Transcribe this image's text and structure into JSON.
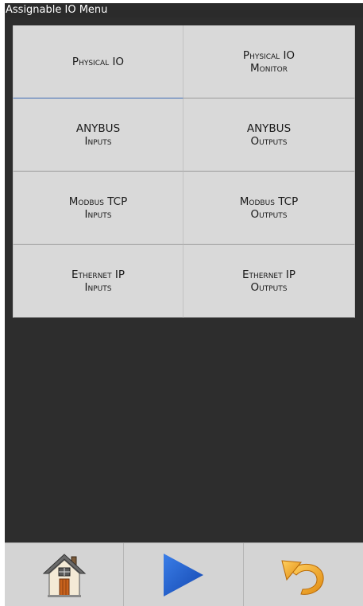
{
  "window": {
    "title": "Assignable IO Menu"
  },
  "menu": {
    "buttons": [
      {
        "line1": "Physical IO",
        "line2": ""
      },
      {
        "line1": "Physical IO",
        "line2": "Monitor"
      },
      {
        "line1": "ANYBUS",
        "line2": "Inputs"
      },
      {
        "line1": "ANYBUS",
        "line2": "Outputs"
      },
      {
        "line1": "Modbus TCP",
        "line2": "Inputs"
      },
      {
        "line1": "Modbus TCP",
        "line2": "Outputs"
      },
      {
        "line1": "Ethernet IP",
        "line2": "Inputs"
      },
      {
        "line1": "Ethernet IP",
        "line2": "Outputs"
      }
    ]
  },
  "toolbar": {
    "icons": [
      "home-icon",
      "play-icon",
      "undo-icon"
    ]
  },
  "colors": {
    "background": "#2d2d2d",
    "button_face": "#d9d9d9",
    "play_blue": "#1f5fd0",
    "undo_orange": "#f0a020"
  }
}
